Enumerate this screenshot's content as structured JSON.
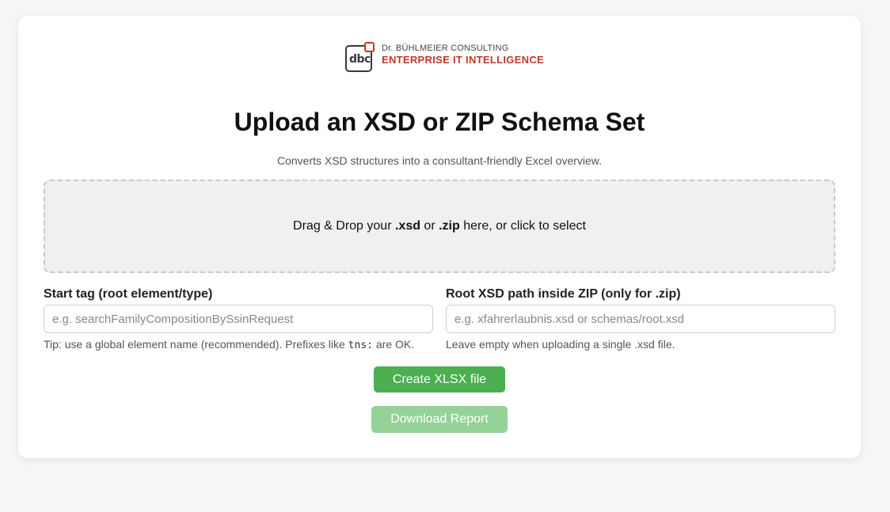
{
  "logo": {
    "mark_text": "dbc",
    "subtitle": "Dr. BÜHLMEIER CONSULTING",
    "tagline": "ENTERPRISE IT INTELLIGENCE"
  },
  "header": {
    "title": "Upload an XSD or ZIP Schema Set",
    "subtitle": "Converts XSD structures into a consultant-friendly Excel overview."
  },
  "dropzone": {
    "prefix": "Drag & Drop your ",
    "ext1": ".xsd",
    "or": " or ",
    "ext2": ".zip",
    "suffix": " here, or click to select"
  },
  "start_tag": {
    "label": "Start tag (root element/type)",
    "placeholder": "e.g. searchFamilyCompositionBySsinRequest",
    "value": "",
    "hint_prefix": "Tip: use a global element name (recommended). Prefixes like ",
    "hint_code": "tns:",
    "hint_suffix": " are OK."
  },
  "root_path": {
    "label": "Root XSD path inside ZIP (only for .zip)",
    "placeholder": "e.g. xfahrerlaubnis.xsd or schemas/root.xsd",
    "value": "",
    "hint": "Leave empty when uploading a single .xsd file."
  },
  "actions": {
    "create_label": "Create XLSX file",
    "download_label": "Download Report"
  },
  "colors": {
    "brand_red": "#c0392b",
    "create_button": "#4caf50",
    "download_button_disabled": "#94d298"
  }
}
